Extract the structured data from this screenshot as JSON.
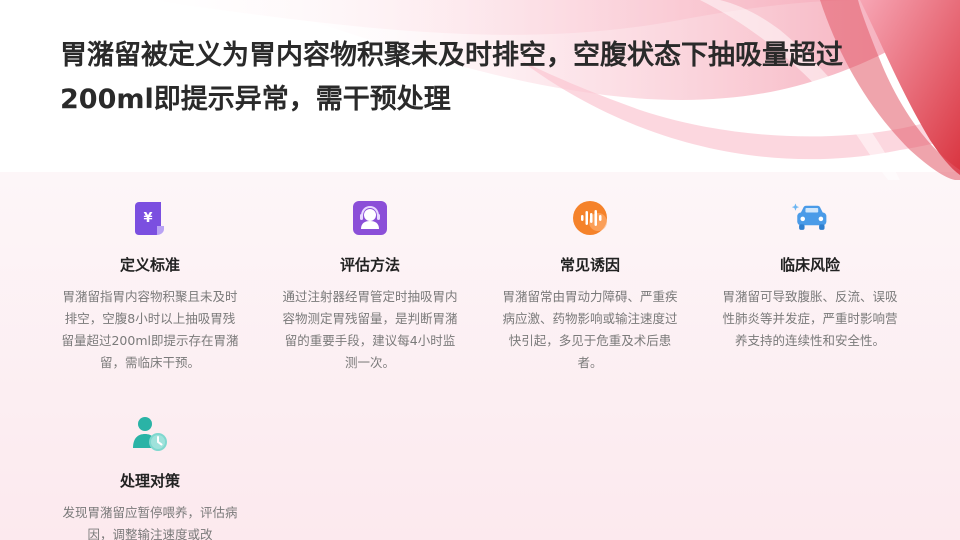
{
  "slide": {
    "title": "胃潴留被定义为胃内容物积聚未及时排空，空腹状态下抽吸量超过200ml即提示异常，需干预处理"
  },
  "cards": [
    {
      "icon": "document-yen-icon",
      "label": "定义标准",
      "desc": "胃潴留指胃内容物积聚且未及时排空，空腹8小时以上抽吸胃残留量超过200ml即提示存在胃潴留，需临床干预。"
    },
    {
      "icon": "support-agent-icon",
      "label": "评估方法",
      "desc": "通过注射器经胃管定时抽吸胃内容物测定胃残留量，是判断胃潴留的重要手段，建议每4小时监测一次。"
    },
    {
      "icon": "audio-wave-icon",
      "label": "常见诱因",
      "desc": "胃潴留常由胃动力障碍、严重疾病应激、药物影响或输注速度过快引起，多见于危重及术后患者。"
    },
    {
      "icon": "car-sparkle-icon",
      "label": "临床风险",
      "desc": "胃潴留可导致腹胀、反流、误吸性肺炎等并发症，严重时影响营养支持的连续性和安全性。"
    },
    {
      "icon": "person-clock-icon",
      "label": "处理对策",
      "desc": "发现胃潴留应暂停喂养，评估病因，调整输注速度或改"
    }
  ],
  "colors": {
    "title": "#2a2a2a",
    "card_label": "#222222",
    "card_desc": "#7a7a7a",
    "icon_purple": "#7b4fe0",
    "icon_orange": "#f5822a",
    "icon_blue": "#4a9be8",
    "icon_teal": "#2ab3a6",
    "deco_red": "#d9343f",
    "deco_pink": "#f3a3b3"
  }
}
